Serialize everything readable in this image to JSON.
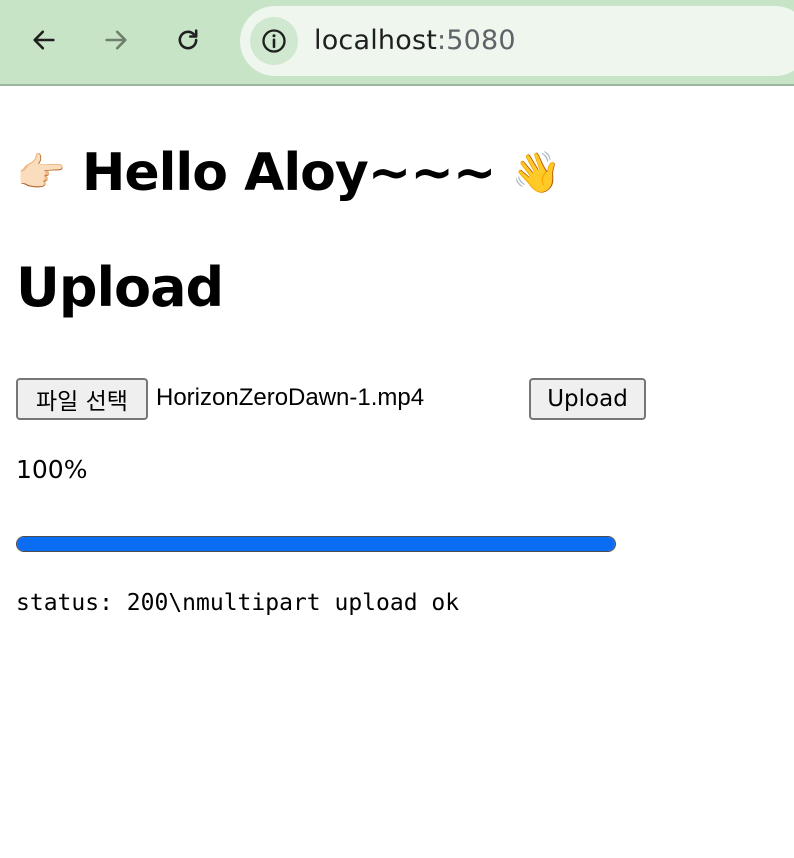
{
  "browser": {
    "url_host": "localhost",
    "url_port": ":5080",
    "nav": {
      "back_icon": "arrow-left-icon",
      "forward_icon": "arrow-right-icon",
      "reload_icon": "reload-icon",
      "site_info_icon": "info-icon"
    }
  },
  "page": {
    "greeting": "Hello Aloy~~~",
    "greeting_left_emoji": "👉🏻",
    "greeting_right_emoji": "👋",
    "section_title": "Upload",
    "file_input": {
      "button_label": "파일 선택",
      "selected_file": "HorizonZeroDawn-1.mp4"
    },
    "upload_button_label": "Upload",
    "progress_text": "100%",
    "progress_value": 1.0,
    "status_text": "status: 200\\nmultipart upload ok"
  },
  "colors": {
    "chrome_bg": "#c7e5c6",
    "omnibox_bg": "#eef6ee",
    "progress_fill": "#0a6cf3"
  }
}
